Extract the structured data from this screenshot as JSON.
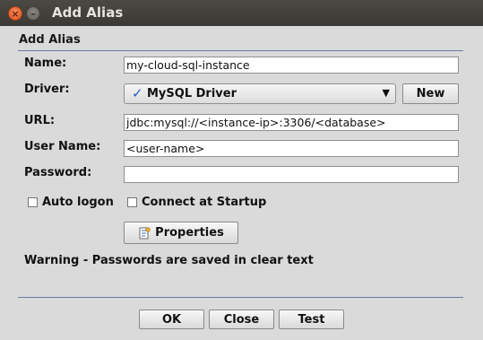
{
  "window": {
    "title": "Add Alias",
    "close_glyph": "×",
    "minimize_glyph": "–"
  },
  "section_title": "Add Alias",
  "form": {
    "name": {
      "label": "Name:",
      "value": "my-cloud-sql-instance"
    },
    "driver": {
      "label": "Driver:",
      "selected": "MySQL Driver",
      "new_button": "New",
      "check_glyph": "✓",
      "arrow_glyph": "▼"
    },
    "url": {
      "label": "URL:",
      "value": "jdbc:mysql://<instance-ip>:3306/<database>"
    },
    "user_name": {
      "label": "User Name:",
      "value": "<user-name>"
    },
    "password": {
      "label": "Password:",
      "value": ""
    }
  },
  "options": {
    "auto_logon": "Auto logon",
    "connect_at_startup": "Connect at Startup"
  },
  "properties_button": "Properties",
  "warning": "Warning - Passwords are saved in clear text",
  "buttons": {
    "ok": "OK",
    "close": "Close",
    "test": "Test"
  },
  "colors": {
    "titlebar": "#3c3b37",
    "background": "#dadada",
    "separator": "#6a7da0",
    "check_accent": "#2a58c8",
    "close_button": "#e0531e"
  },
  "icons": {
    "driver_check": "checkmark-icon",
    "combo_arrow": "dropdown-arrow-icon",
    "properties": "properties-icon"
  }
}
